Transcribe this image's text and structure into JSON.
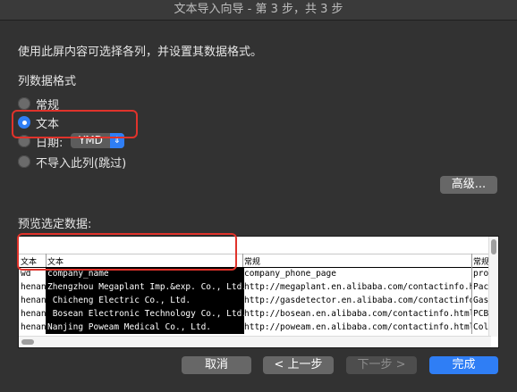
{
  "window": {
    "title": "文本导入向导 - 第 3 步，共 3 步"
  },
  "instruction": "使用此屏内容可选择各列，并设置其数据格式。",
  "column_format": {
    "title": "列数据格式",
    "options": [
      {
        "label": "常规",
        "selected": false
      },
      {
        "label": "文本",
        "selected": true
      },
      {
        "label": "日期:",
        "selected": false
      },
      {
        "label": "不导入此列(跳过)",
        "selected": false
      }
    ],
    "date_format": {
      "value": "YMD",
      "icon": "chevron-updown-icon"
    }
  },
  "advanced_button": "高级...",
  "preview": {
    "label": "预览选定数据:",
    "headers": [
      "文本",
      "文本",
      "常规",
      "常规"
    ],
    "rows": [
      [
        "wd",
        "company_name",
        "company_phone_page",
        "prod"
      ],
      [
        "henan",
        "Zhengzhou Megaplant Imp.&exp. Co., Ltd.",
        "http://megaplant.en.alibaba.com/contactinfo.html",
        "Pack"
      ],
      [
        "henan",
        " Chicheng Electric Co., Ltd.",
        "http://gasdetector.en.alibaba.com/contactinfo.html",
        "Gas"
      ],
      [
        "henan",
        " Bosean Electronic Technology Co., Ltd.",
        "http://bosean.en.alibaba.com/contactinfo.html",
        "PCB,"
      ],
      [
        "henan",
        "Nanjing Poweam Medical Co., Ltd.",
        "http://poweam.en.alibaba.com/contactinfo.html",
        "Colo"
      ]
    ]
  },
  "buttons": {
    "cancel": "取消",
    "back": "< 上一步",
    "next": "下一步 >",
    "finish": "完成"
  },
  "colors": {
    "accent": "#2f7ef5",
    "highlight": "#e0332b",
    "background": "#323232"
  }
}
